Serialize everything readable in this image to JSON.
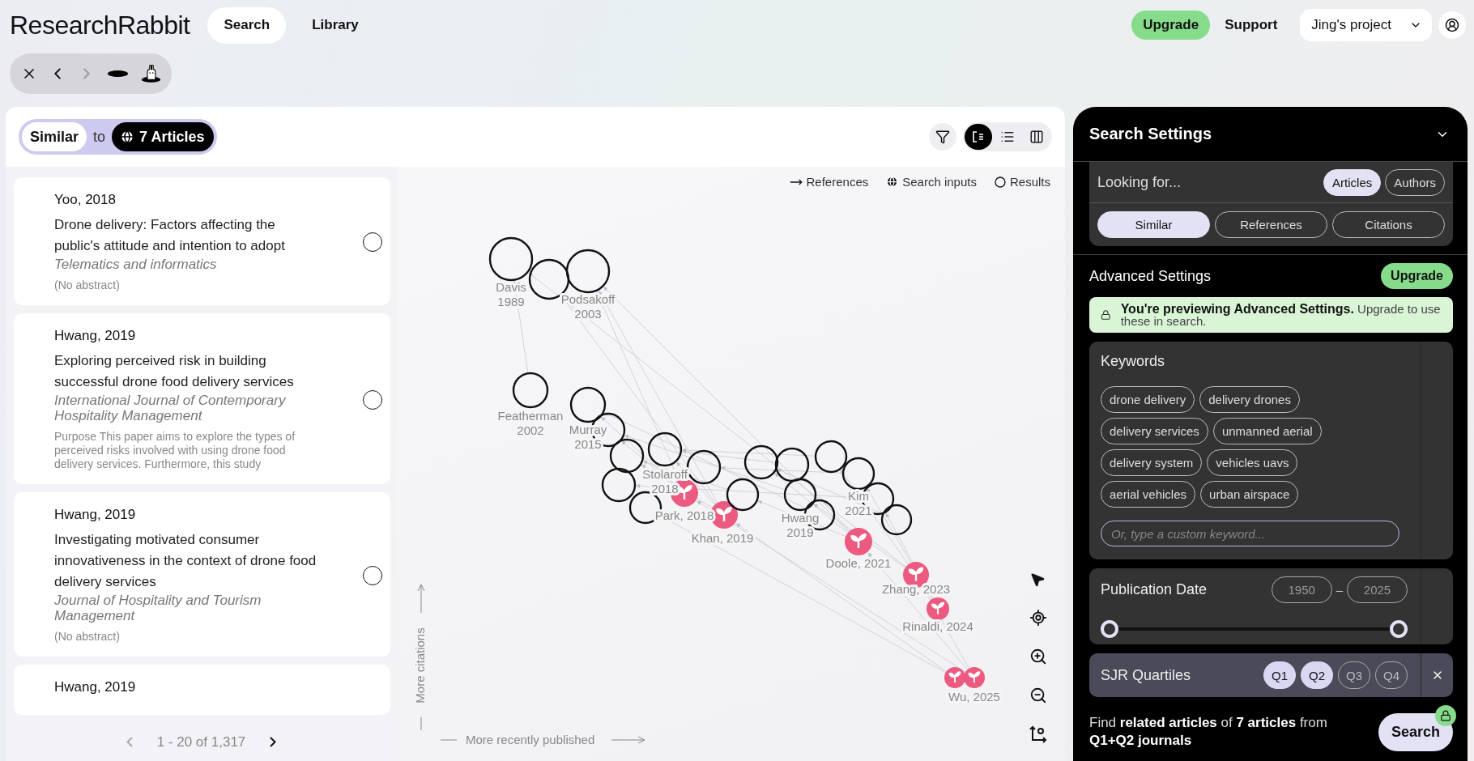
{
  "top_bar": {
    "logo": "ResearchRabbit",
    "tabs": [
      {
        "label": "Search",
        "selected": true
      },
      {
        "label": "Library",
        "selected": false
      }
    ],
    "upgrade": "Upgrade",
    "support": "Support",
    "project": "Jing's project"
  },
  "history_toolbar": {
    "back_disabled": false,
    "forward_disabled": true
  },
  "results_panel": {
    "similar_label": "Similar",
    "connector": "to",
    "inputs_label": "7 Articles",
    "view_modes": [
      {
        "kind": "graph",
        "selected": true
      },
      {
        "kind": "list",
        "selected": false
      },
      {
        "kind": "columns",
        "selected": false
      }
    ],
    "articles": [
      {
        "author_year": "Yoo, 2018",
        "title": "Drone delivery: Factors affecting the public's attitude and intention to adopt",
        "journal": "Telematics and informatics",
        "abstract": "(No abstract)",
        "selected": false
      },
      {
        "author_year": "Hwang, 2019",
        "title": "Exploring perceived risk in building successful drone food delivery services",
        "journal": "International Journal of Contemporary Hospitality Management",
        "abstract": "Purpose This paper aims to explore the types of perceived risks involved with using drone food delivery services. Furthermore, this study",
        "selected": false
      },
      {
        "author_year": "Hwang, 2019",
        "title": "Investigating motivated consumer innovativeness in the context of drone food delivery services",
        "journal": "Journal of Hospitality and Tourism Management",
        "abstract": "(No abstract)",
        "selected": false
      },
      {
        "author_year": "Hwang, 2019"
      }
    ],
    "pagination": {
      "prev_disabled": true,
      "range": "1 - 20 of 1,317",
      "next_disabled": false
    }
  },
  "graph": {
    "legend": [
      {
        "kind": "arrow",
        "label": "References"
      },
      {
        "kind": "globe",
        "label": "Search inputs"
      },
      {
        "kind": "circle",
        "label": "Results"
      }
    ],
    "nodes": [
      {
        "kind": "result",
        "label": [
          "Davis",
          "1989"
        ]
      },
      {
        "kind": "result"
      },
      {
        "kind": "result",
        "label": [
          "Podsakoff",
          "2003"
        ]
      },
      {
        "kind": "result",
        "label": [
          "Featherman",
          "2002"
        ]
      },
      {
        "kind": "result"
      },
      {
        "kind": "result",
        "label": [
          "Murray",
          "2015"
        ]
      },
      {
        "kind": "result"
      },
      {
        "kind": "result",
        "label": [
          "Stolaroff",
          "2018"
        ]
      },
      {
        "kind": "result"
      },
      {
        "kind": "result"
      },
      {
        "kind": "result"
      },
      {
        "kind": "input",
        "label": [
          "Park, 2018"
        ]
      },
      {
        "kind": "input",
        "label": [
          "Khan, 2019"
        ]
      },
      {
        "kind": "result"
      },
      {
        "kind": "result"
      },
      {
        "kind": "result"
      },
      {
        "kind": "result",
        "label": [
          "Hwang",
          "2019"
        ]
      },
      {
        "kind": "result"
      },
      {
        "kind": "result"
      },
      {
        "kind": "result",
        "label": [
          "Kim",
          "2021"
        ]
      },
      {
        "kind": "result"
      },
      {
        "kind": "result"
      },
      {
        "kind": "input",
        "label": [
          "Doole, 2021"
        ]
      },
      {
        "kind": "input",
        "label": [
          "Zhang, 2023"
        ]
      },
      {
        "kind": "input",
        "label": [
          "Rinaldi, 2024"
        ]
      },
      {
        "kind": "input"
      },
      {
        "kind": "input",
        "label": [
          "Wu, 2025"
        ]
      }
    ],
    "y_axis": "More citations",
    "x_axis": "More recently published"
  },
  "search_settings": {
    "title": "Search Settings",
    "looking_for": {
      "label": "Looking for...",
      "options": [
        {
          "label": "Articles",
          "selected": true
        },
        {
          "label": "Authors",
          "selected": false
        }
      ]
    },
    "relations": [
      {
        "label": "Similar",
        "selected": true
      },
      {
        "label": "References",
        "selected": false
      },
      {
        "label": "Citations",
        "selected": false
      }
    ],
    "advanced": {
      "title": "Advanced Settings",
      "upgrade": "Upgrade",
      "notice": "**You're previewing Advanced Settings.** Upgrade to use these in search.",
      "keywords": {
        "title": "Keywords",
        "chips": [
          "drone delivery",
          "delivery drones",
          "delivery services",
          "unmanned aerial",
          "delivery system",
          "vehicles uavs",
          "aerial vehicles",
          "urban airspace"
        ],
        "placeholder": "Or, type a custom keyword..."
      },
      "publication_date": {
        "title": "Publication Date",
        "from": "1950",
        "separator": "–",
        "to": "2025",
        "thumbs": [
          {
            "level": 0
          },
          {
            "level": 1
          }
        ]
      },
      "sjr": {
        "title": "SJR Quartiles",
        "quartiles": [
          {
            "label": "Q1",
            "selected": true
          },
          {
            "label": "Q2",
            "selected": true
          },
          {
            "label": "Q3",
            "selected": false
          },
          {
            "label": "Q4",
            "selected": false
          }
        ]
      }
    },
    "footer": {
      "summary": "Find **related articles** of **7 articles** from **Q1+Q2 journals**",
      "button": "Search",
      "locked": true
    }
  }
}
